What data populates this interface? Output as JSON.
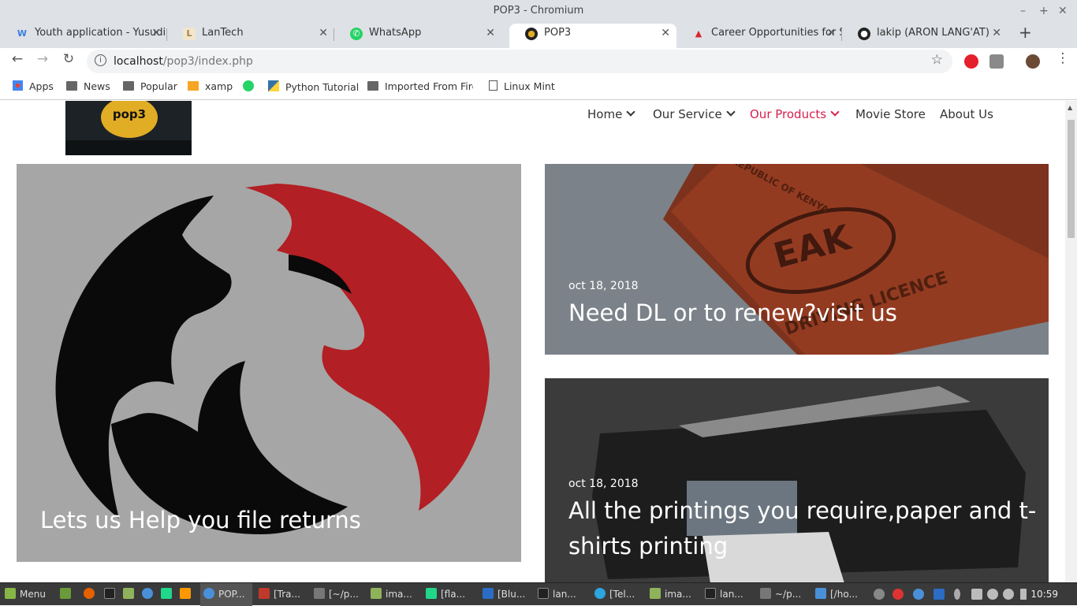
{
  "window": {
    "title": "POP3 - Chromium",
    "controls": [
      "–",
      "+",
      "✕"
    ]
  },
  "tabs": [
    {
      "title": "Youth application - Yusudi",
      "icon": "W",
      "color": "#3b7ddd"
    },
    {
      "title": "LanTech",
      "icon": "L",
      "color": "#c9a96e"
    },
    {
      "title": "WhatsApp",
      "icon": "✆",
      "color": "#25d366"
    },
    {
      "title": "POP3",
      "icon": "●",
      "color": "#222222"
    },
    {
      "title": "Career Opportunities for S",
      "icon": "▲",
      "color": "#d9262c"
    },
    {
      "title": "lakip (ARON LANG'AT)",
      "icon": "●",
      "color": "#222222"
    }
  ],
  "toolbar": {
    "url_host": "localhost",
    "url_path": "/pop3/index.php"
  },
  "bookmarks": [
    "Apps",
    "News",
    "Popular",
    "xamp",
    "Python Tutorial",
    "Imported From Firef",
    "Linux Mint"
  ],
  "site": {
    "logo_text": "pop3",
    "nav": [
      {
        "label": "Home",
        "dropdown": true
      },
      {
        "label": "Our Service",
        "dropdown": true
      },
      {
        "label": "Our Products",
        "dropdown": true,
        "active": true
      },
      {
        "label": "Movie Store",
        "dropdown": false
      },
      {
        "label": "About Us",
        "dropdown": false
      }
    ],
    "cards": [
      {
        "headline": "Lets us Help you file returns",
        "date": ""
      },
      {
        "headline": "Need DL or to renew?visit us",
        "date": "oct 18, 2018",
        "licence_text": "EAK",
        "licence_subtext": "DRIVING LICENCE",
        "licence_top": "REPUBLIC OF KENYA"
      },
      {
        "headline_line1": "All the printings you require,paper and t-",
        "headline_line2": "shirts printing",
        "date": "oct 18, 2018"
      }
    ],
    "accent_color": "#d6204f"
  },
  "taskbar": {
    "menu_label": "Menu",
    "windows": [
      "POP...",
      "[Tra...",
      "[~/p...",
      "ima...",
      "[fla...",
      "[Blu...",
      "lan...",
      "[Tel...",
      "ima...",
      "lan...",
      "~/p...",
      "[/ho..."
    ],
    "clock": "10:59"
  }
}
